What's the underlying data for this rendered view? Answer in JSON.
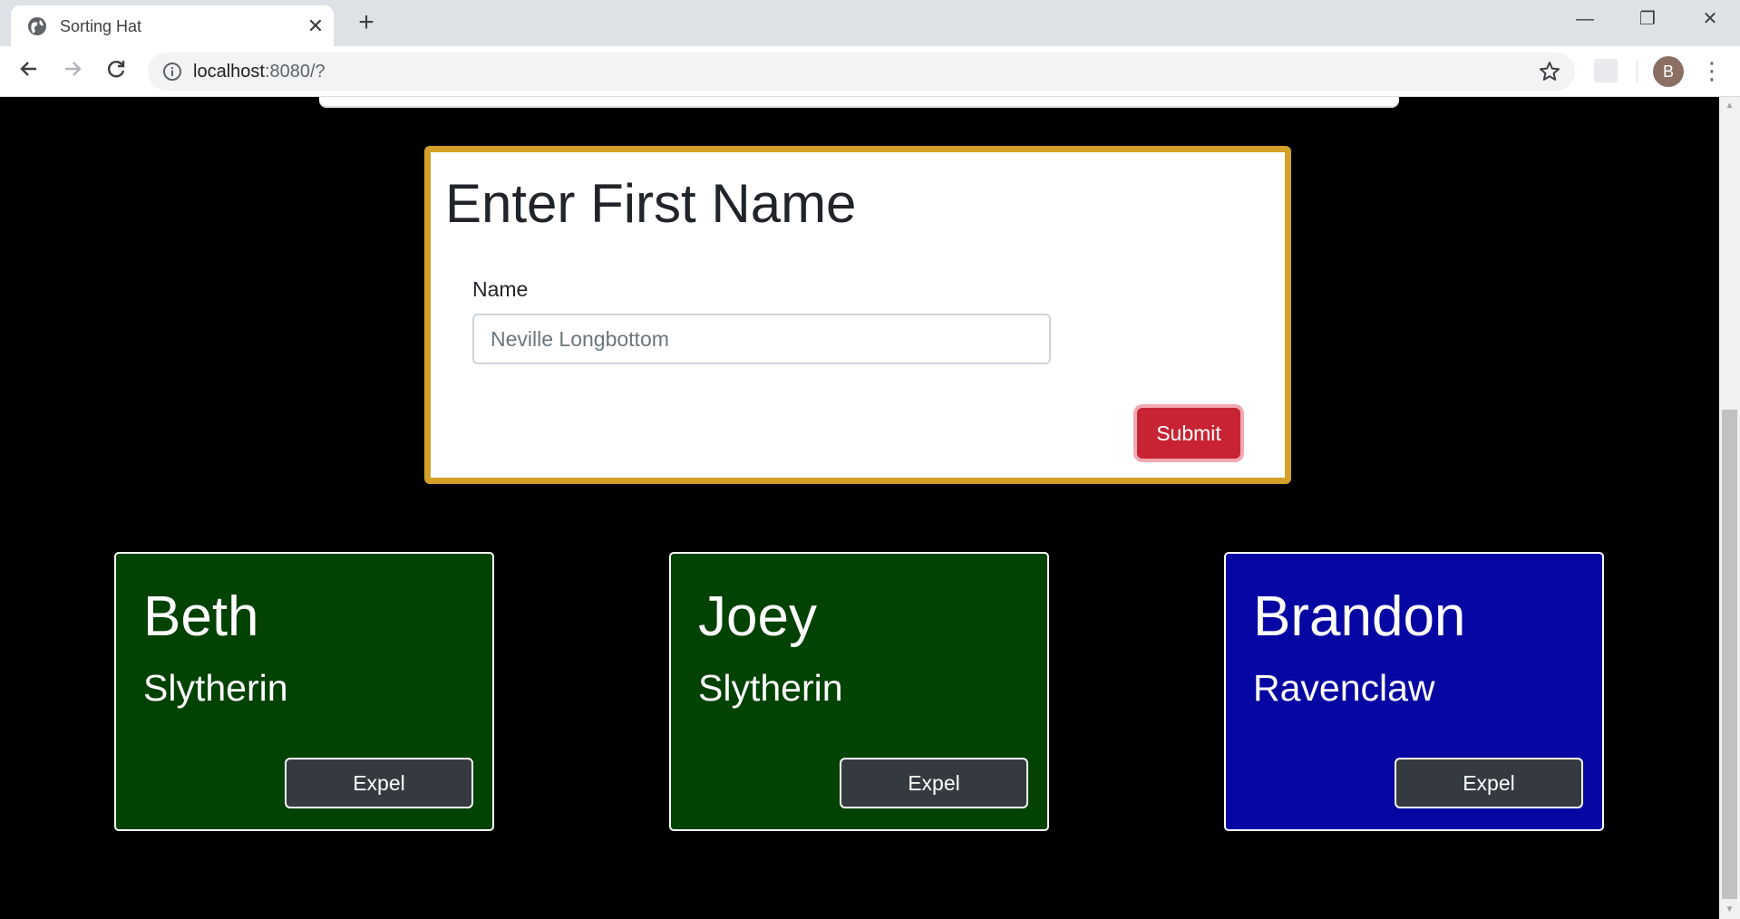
{
  "browser": {
    "tab_title": "Sorting Hat",
    "tab_close": "✕",
    "new_tab": "+",
    "url_host": "localhost",
    "url_path": ":8080/?",
    "avatar_letter": "B",
    "window_controls": {
      "minimize": "—",
      "restore": "❐",
      "close": "✕"
    }
  },
  "form": {
    "title": "Enter First Name",
    "label": "Name",
    "input_value": "",
    "input_placeholder": "Neville Longbottom",
    "submit_label": "Submit"
  },
  "students": [
    {
      "name": "Beth",
      "house": "Slytherin",
      "color": "#024202",
      "expel_label": "Expel"
    },
    {
      "name": "Joey",
      "house": "Slytherin",
      "color": "#024202",
      "expel_label": "Expel"
    },
    {
      "name": "Brandon",
      "house": "Ravenclaw",
      "color": "#0606a2",
      "expel_label": "Expel"
    }
  ],
  "colors": {
    "page_background": "#000000",
    "form_border": "#d4a02a",
    "submit_button": "#c82333",
    "expel_button": "#343a40"
  }
}
